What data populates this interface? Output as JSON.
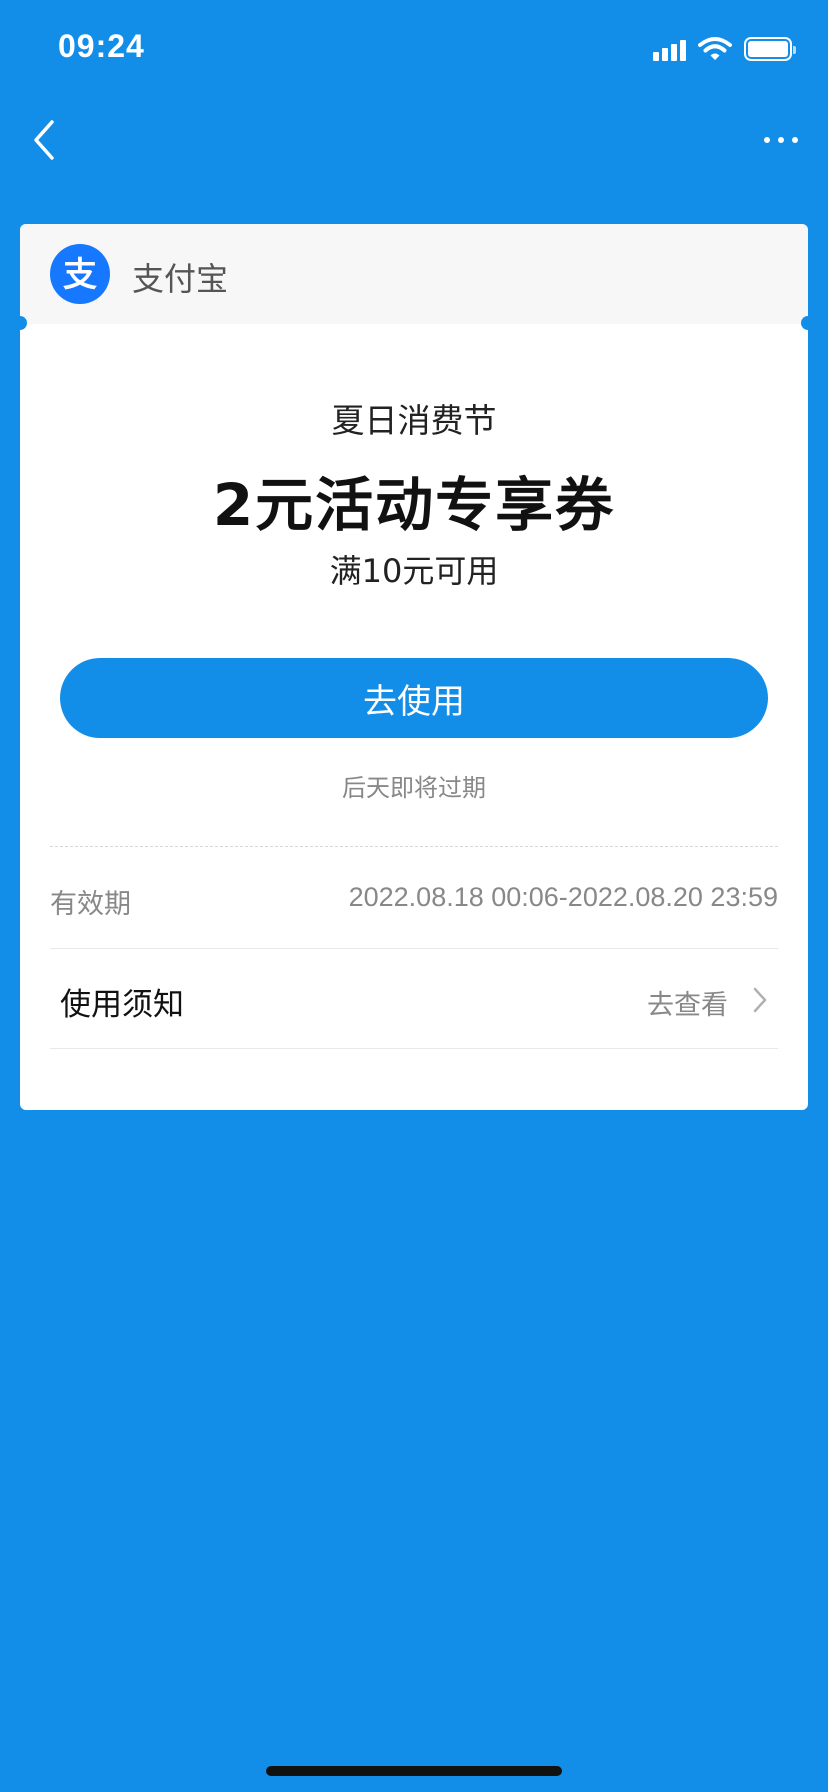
{
  "status_bar": {
    "time": "09:24",
    "icons": [
      "signal-icon",
      "wifi-icon",
      "battery-icon"
    ]
  },
  "nav": {
    "back_icon": "chevron-left-icon",
    "more_icon": "more-dots-icon"
  },
  "card": {
    "brand_name": "支付宝",
    "brand_logo_glyph": "支",
    "event_name": "夏日消费节",
    "coupon_title": "2元活动专享券",
    "condition": "满10元可用",
    "use_button_label": "去使用",
    "expiry_note": "后天即将过期",
    "validity": {
      "label": "有效期",
      "value": "2022.08.18 00:06-2022.08.20 23:59"
    },
    "notice": {
      "label": "使用须知",
      "link_label": "去查看"
    }
  },
  "colors": {
    "background": "#128ee9",
    "accent": "#128ee9",
    "brand_logo": "#1677ff",
    "card": "#ffffff",
    "muted_text": "#888888"
  }
}
